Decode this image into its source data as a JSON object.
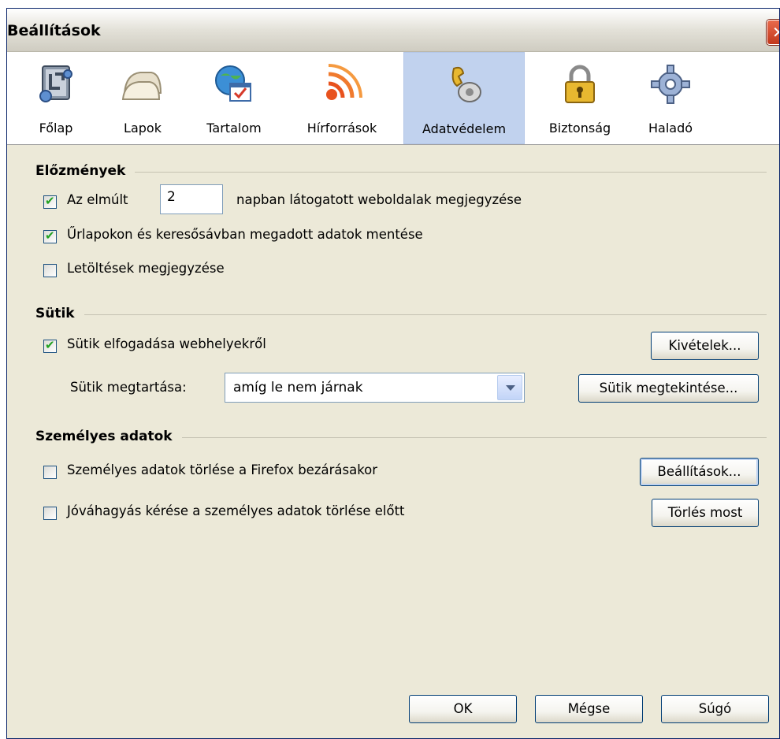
{
  "window": {
    "title": "Beállítások"
  },
  "toolbar": {
    "panes": [
      {
        "label": "Főlap",
        "icon": "main-icon"
      },
      {
        "label": "Lapok",
        "icon": "tabs-icon"
      },
      {
        "label": "Tartalom",
        "icon": "content-icon"
      },
      {
        "label": "Hírforrások",
        "icon": "feeds-icon"
      },
      {
        "label": "Adatvédelem",
        "icon": "privacy-icon",
        "selected": true
      },
      {
        "label": "Biztonság",
        "icon": "lock-icon"
      },
      {
        "label": "Haladó",
        "icon": "gear-icon"
      }
    ]
  },
  "history": {
    "caption": "Előzmények",
    "remember_prefix": "Az elmúlt",
    "days_value": "2",
    "remember_suffix": "napban látogatott weboldalak megjegyzése",
    "remember_checked": true,
    "forms": "Űrlapokon és keresősávban megadott adatok mentése",
    "forms_checked": true,
    "downloads": "Letöltések megjegyzése",
    "downloads_checked": false
  },
  "cookies": {
    "caption": "Sütik",
    "accept": "Sütik elfogadása webhelyekről",
    "accept_checked": true,
    "exceptions_button": "Kivételek...",
    "keep_label": "Sütik megtartása:",
    "keep_value": "amíg le nem járnak",
    "show_button": "Sütik megtekintése..."
  },
  "private_data": {
    "caption": "Személyes adatok",
    "clear_on_close": "Személyes adatok törlése a Firefox bezárásakor",
    "clear_on_close_checked": false,
    "ask": "Jóváhagyás kérése a személyes adatok törlése előtt",
    "ask_checked": false,
    "settings_button": "Beállítások...",
    "clear_now_button": "Törlés most"
  },
  "footer": {
    "ok": "OK",
    "cancel": "Mégse",
    "help": "Súgó"
  }
}
